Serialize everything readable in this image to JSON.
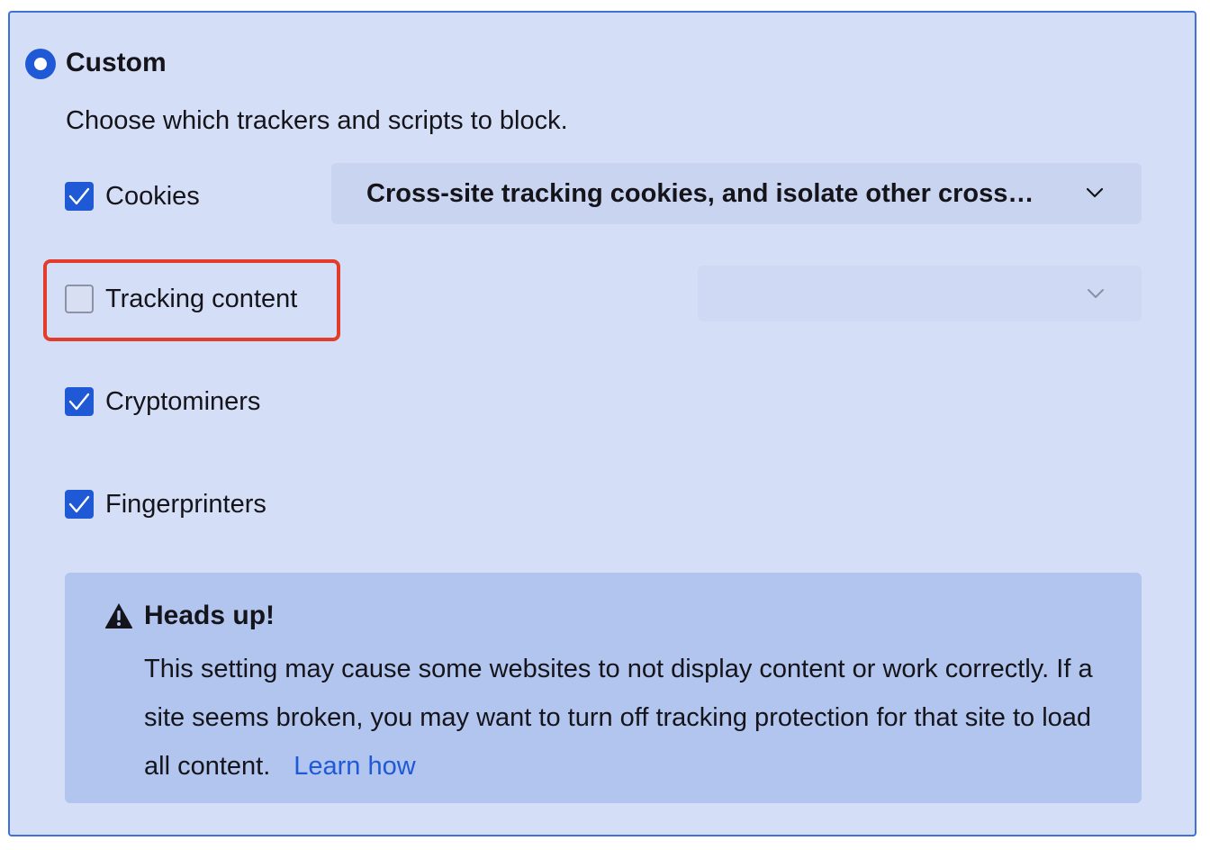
{
  "custom": {
    "title": "Custom",
    "description": "Choose which trackers and scripts to block.",
    "selected": true
  },
  "options": {
    "cookies": {
      "label": "Cookies",
      "checked": true,
      "dropdown_value": "Cross-site tracking cookies, and isolate other cross…"
    },
    "tracking_content": {
      "label": "Tracking content",
      "checked": false,
      "dropdown_value": ""
    },
    "cryptominers": {
      "label": "Cryptominers",
      "checked": true
    },
    "fingerprinters": {
      "label": "Fingerprinters",
      "checked": true
    }
  },
  "callout": {
    "icon": "warning-icon",
    "title": "Heads up!",
    "body": "This setting may cause some websites to not display content or work correctly. If a site seems broken, you may want to turn off tracking protection for that site to load all content.",
    "link_label": "Learn how"
  },
  "colors": {
    "panel_bg": "#d4dff7",
    "accent": "#1f59d6",
    "callout_bg": "#b1c5ef",
    "highlight": "#e23d2a"
  }
}
